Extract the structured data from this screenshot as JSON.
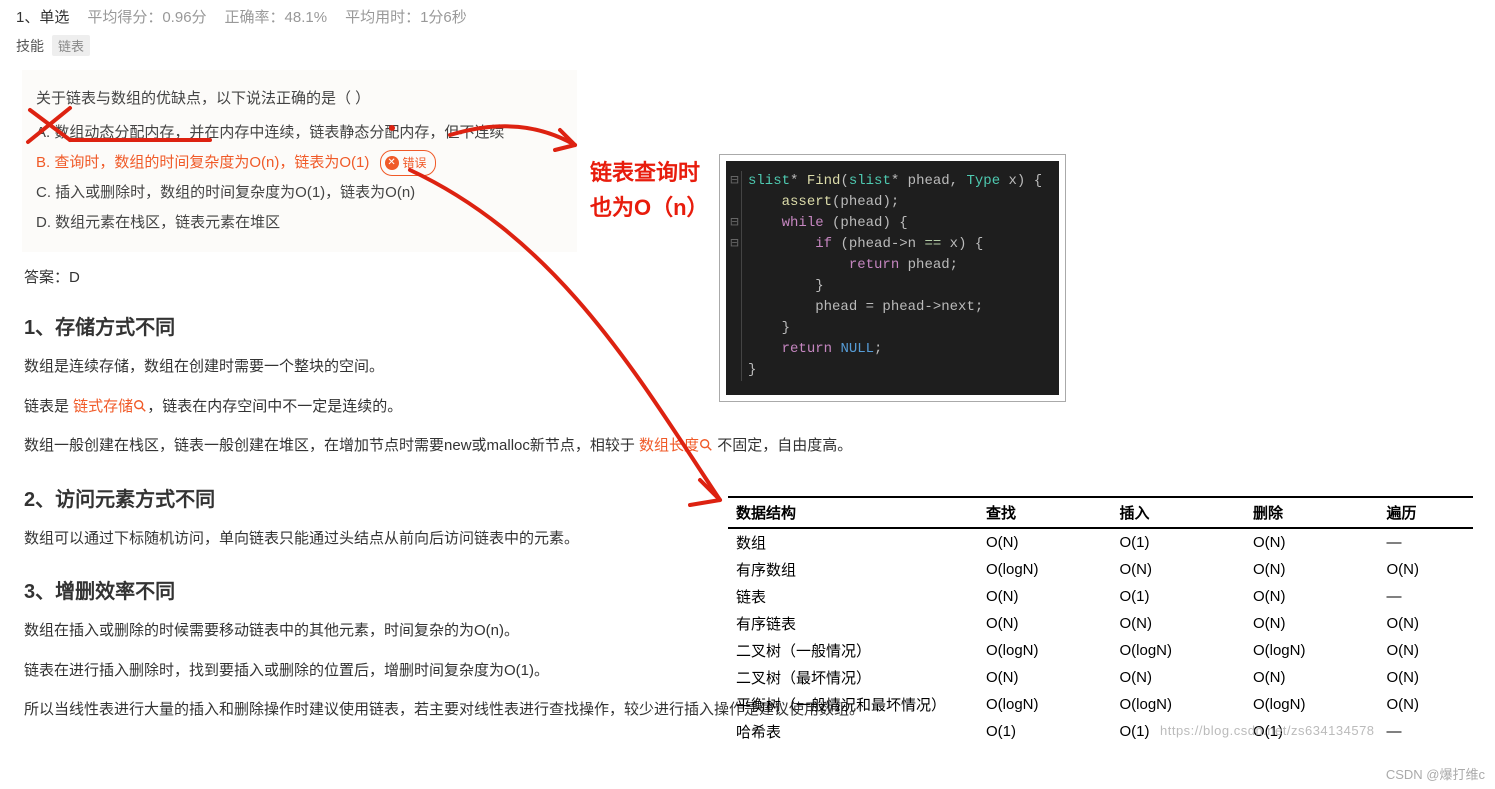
{
  "header": {
    "qno": "1、单选",
    "avg_score_label": "平均得分：0.96分",
    "correct_rate_label": "正确率：48.1%",
    "avg_time_label": "平均用时：1分6秒"
  },
  "skill": {
    "label": "技能",
    "tag": "链表"
  },
  "question": {
    "stem": "关于链表与数组的优缺点，以下说法正确的是（ ）",
    "opts": {
      "A": "A. 数组动态分配内存，并在内存中连续，链表静态分配内存，但不连续",
      "B": "B. 查询时，数组的时间复杂度为O(n)，链表为O(1)",
      "C": "C. 插入或删除时，数组的时间复杂度为O(1)，链表为O(n)",
      "D": "D. 数组元素在栈区，链表元素在堆区"
    },
    "wrong_badge": "错误"
  },
  "answer": "答案：D",
  "annotation_lines": [
    "链表查询时",
    "也为O（n）"
  ],
  "explain": {
    "h1": "1、存储方式不同",
    "p1a": "数组是连续存储，数组在创建时需要一个整块的空间。",
    "p1b_pre": "链表是 ",
    "p1b_link": "链式存储",
    "p1b_post": "，链表在内存空间中不一定是连续的。",
    "p1c_pre": "数组一般创建在栈区，链表一般创建在堆区，在增加节点时需要new或malloc新节点，相较于 ",
    "p1c_link": "数组长度",
    "p1c_post": " 不固定，自由度高。",
    "h2": "2、访问元素方式不同",
    "p2": "数组可以通过下标随机访问，单向链表只能通过头结点从前向后访问链表中的元素。",
    "h3": "3、增删效率不同",
    "p3a": "数组在插入或删除的时候需要移动链表中的其他元素，时间复杂的为O(n)。",
    "p3b": "链表在进行插入删除时，找到要插入或删除的位置后，增删时间复杂度为O(1)。",
    "p3c": "所以当线性表进行大量的插入和删除操作时建议使用链表，若主要对线性表进行查找操作，较少进行插入操作是建议使用数组。"
  },
  "code": {
    "l1": "slist* Find(slist* phead, Type x) {",
    "l2": "    assert(phead);",
    "l3": "    while (phead) {",
    "l4": "        if (phead->n == x) {",
    "l5": "            return phead;",
    "l6": "        }",
    "l7": "        phead = phead->next;",
    "l8": "    }",
    "l9": "    return NULL;",
    "l10": "}"
  },
  "table": {
    "headers": [
      "数据结构",
      "查找",
      "插入",
      "删除",
      "遍历"
    ],
    "rows": [
      [
        "数组",
        "O(N)",
        "O(1)",
        "O(N)",
        "—"
      ],
      [
        "有序数组",
        "O(logN)",
        "O(N)",
        "O(N)",
        "O(N)"
      ],
      [
        "链表",
        "O(N)",
        "O(1)",
        "O(N)",
        "—"
      ],
      [
        "有序链表",
        "O(N)",
        "O(N)",
        "O(N)",
        "O(N)"
      ],
      [
        "二叉树（一般情况）",
        "O(logN)",
        "O(logN)",
        "O(logN)",
        "O(N)"
      ],
      [
        "二叉树（最坏情况）",
        "O(N)",
        "O(N)",
        "O(N)",
        "O(N)"
      ],
      [
        "平衡树（一般情况和最坏情况）",
        "O(logN)",
        "O(logN)",
        "O(logN)",
        "O(N)"
      ],
      [
        "哈希表",
        "O(1)",
        "O(1)",
        "O(1)",
        "—"
      ]
    ]
  },
  "watermarks": {
    "table": "https://blog.csdn.net/zs634134578",
    "page": "CSDN @爆打维c"
  }
}
